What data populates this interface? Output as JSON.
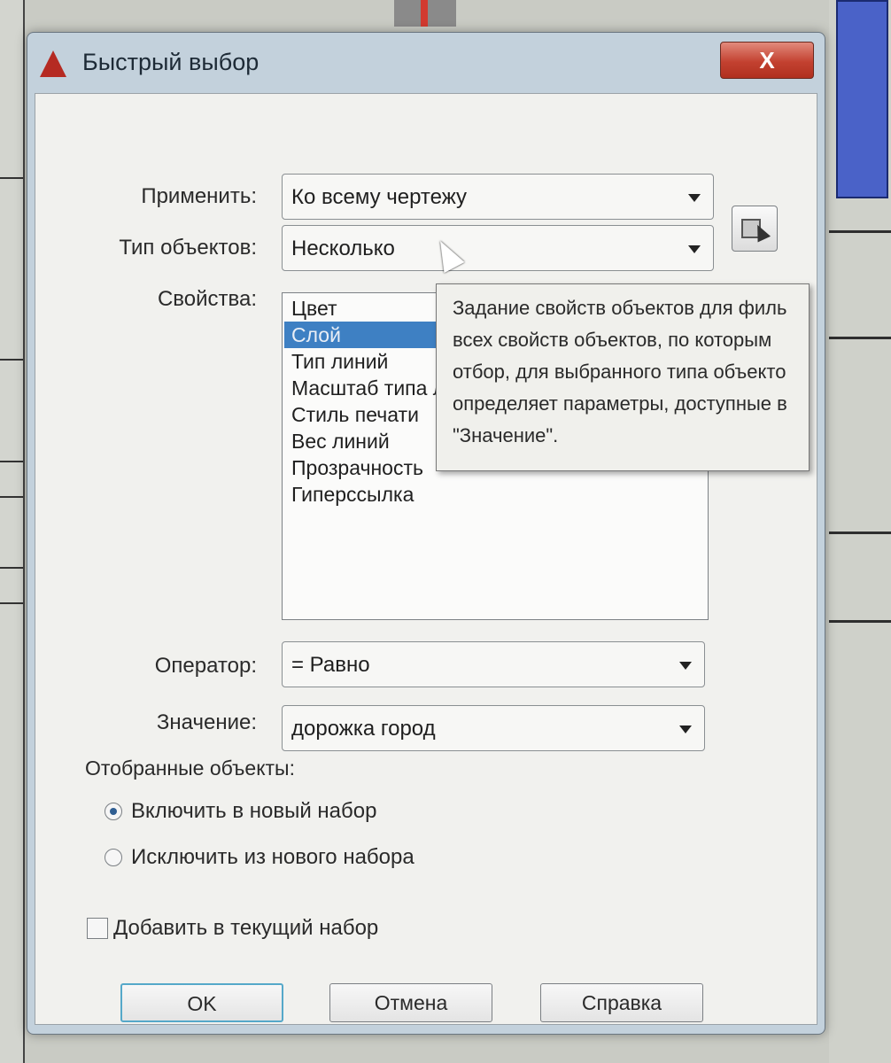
{
  "window": {
    "title": "Быстрый выбор",
    "close_label": "X"
  },
  "apply": {
    "label": "Применить:",
    "value": "Ко всему чертежу"
  },
  "object_type": {
    "label": "Тип объектов:",
    "value": "Несколько"
  },
  "properties": {
    "label": "Свойства:",
    "items": [
      "Цвет",
      "Слой",
      "Тип линий",
      "Масштаб типа ли",
      "Стиль печати",
      "Вес линий",
      "Прозрачность",
      "Гиперссылка"
    ],
    "selected": "Слой"
  },
  "tooltip": {
    "lines": [
      "Задание свойств объектов для филь",
      "всех свойств объектов, по которым",
      "отбор, для выбранного типа объекто",
      "определяет параметры, доступные в",
      "\"Значение\"."
    ]
  },
  "operator": {
    "label": "Оператор:",
    "value": "= Равно"
  },
  "value": {
    "label": "Значение:",
    "value": "дорожка город"
  },
  "selected_objects": {
    "label": "Отобранные объекты:",
    "include_label": "Включить в новый набор",
    "exclude_label": "Исключить из нового набора",
    "include_checked": true
  },
  "append": {
    "label": "Добавить в текущий набор",
    "checked": false
  },
  "buttons": {
    "ok": "OK",
    "cancel": "Отмена",
    "help": "Справка"
  },
  "icons": {
    "app": "autocad-logo-icon",
    "pick": "select-objects-icon"
  }
}
